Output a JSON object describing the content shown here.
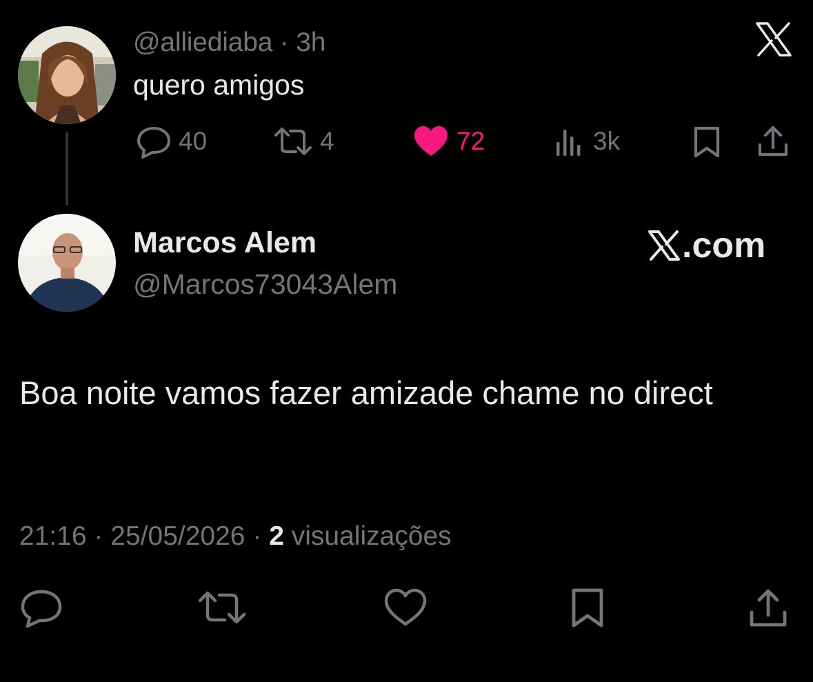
{
  "parent_tweet": {
    "handle": "@alliediaba",
    "separator": "·",
    "time": "3h",
    "text": "quero amigos",
    "actions": {
      "replies": "40",
      "reposts": "4",
      "likes": "72",
      "views": "3k"
    },
    "icons": [
      "reply-icon",
      "repost-icon",
      "heart-filled-icon",
      "views-icon",
      "bookmark-icon",
      "share-icon",
      "x-logo-icon"
    ],
    "like_color": "#f91880"
  },
  "reply_tweet": {
    "display_name": "Marcos Alem",
    "handle": "@Marcos73043Alem",
    "watermark": ".com",
    "text": "Boa noite vamos fazer amizade chame no direct",
    "meta": {
      "time": "21:16",
      "separator": "·",
      "date": "25/05/2026",
      "views_count": "2",
      "views_label": "visualizações"
    },
    "icons": [
      "reply-icon",
      "repost-icon",
      "heart-outline-icon",
      "bookmark-icon",
      "share-icon"
    ]
  },
  "colors": {
    "background": "#000000",
    "text": "#e7e9ea",
    "muted": "#71767b",
    "like": "#f91880"
  }
}
